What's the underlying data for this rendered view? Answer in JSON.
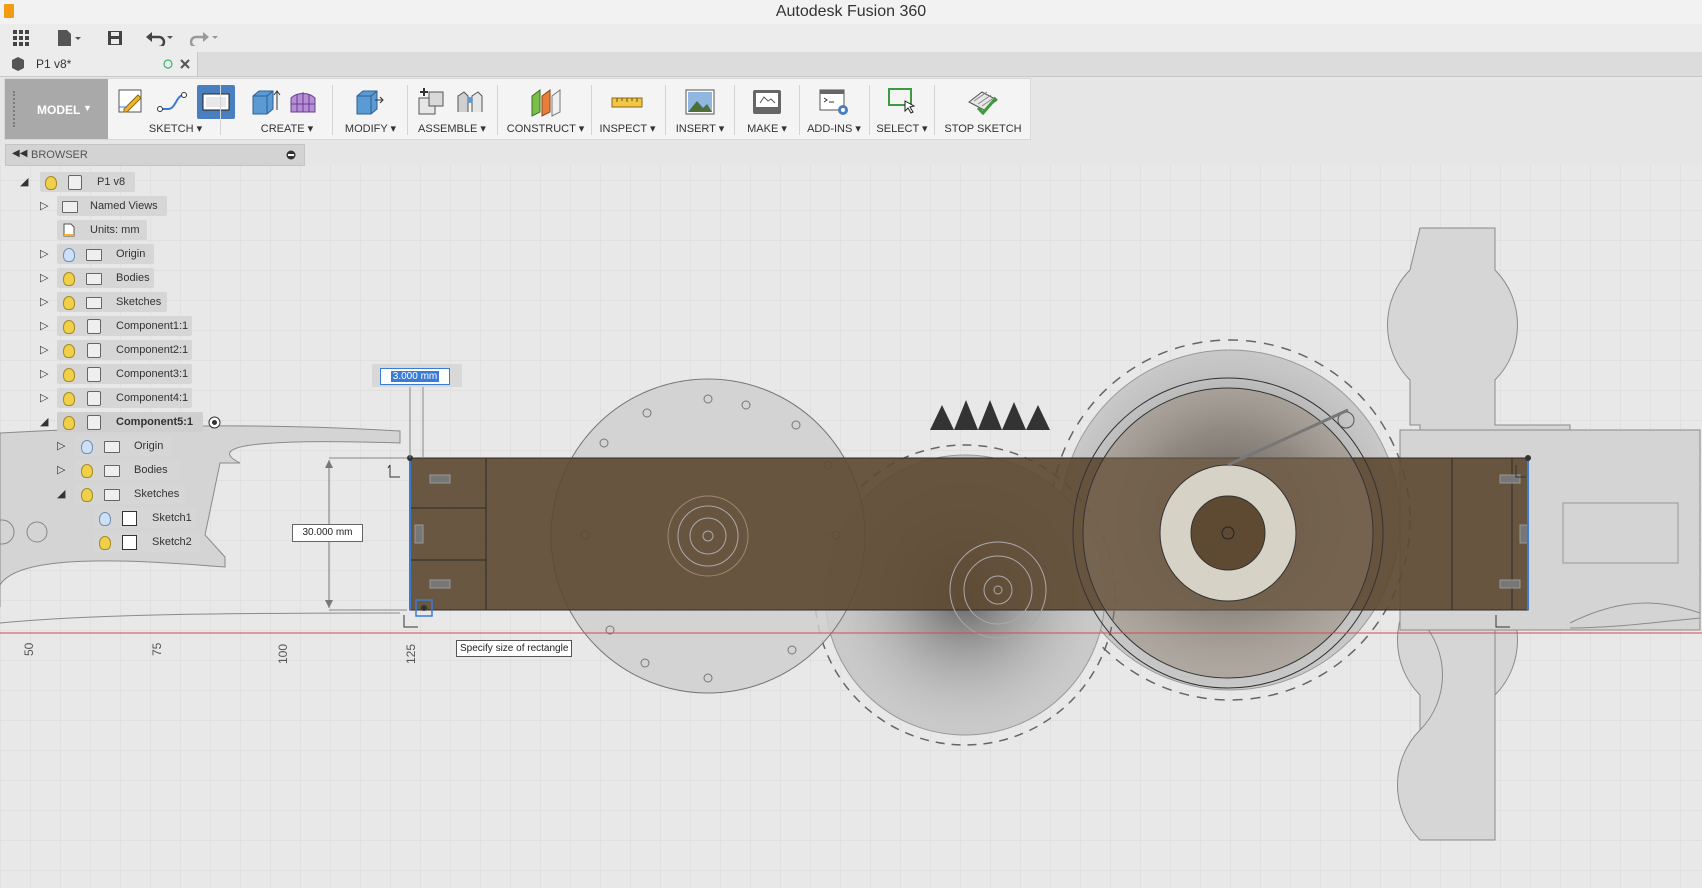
{
  "app": {
    "title": "Autodesk Fusion 360"
  },
  "document": {
    "tab_name": "P1 v8*"
  },
  "toolbar": {
    "workspace": "MODEL",
    "groups": [
      "SKETCH",
      "CREATE",
      "MODIFY",
      "ASSEMBLE",
      "CONSTRUCT",
      "INSPECT",
      "INSERT",
      "MAKE",
      "ADD-INS",
      "SELECT",
      "STOP SKETCH"
    ]
  },
  "browser": {
    "title": "BROWSER",
    "items": [
      {
        "label": "P1 v8"
      },
      {
        "label": "Named Views"
      },
      {
        "label": "Units: mm"
      },
      {
        "label": "Origin"
      },
      {
        "label": "Bodies"
      },
      {
        "label": "Sketches"
      },
      {
        "label": "Component1:1"
      },
      {
        "label": "Component2:1"
      },
      {
        "label": "Component3:1"
      },
      {
        "label": "Component4:1"
      },
      {
        "label": "Component5:1"
      },
      {
        "label": "Origin"
      },
      {
        "label": "Bodies"
      },
      {
        "label": "Sketches"
      },
      {
        "label": "Sketch1"
      },
      {
        "label": "Sketch2"
      }
    ]
  },
  "canvas": {
    "dimension_input": "3.000 mm",
    "dimension_height": "30.000 mm",
    "tooltip": "Specify size of rectangle",
    "ruler_labels": [
      "50",
      "75",
      "100",
      "125"
    ]
  },
  "colors": {
    "body_fill": "#5e4a33",
    "selection_blue": "#3a7bd5",
    "axis_red": "#d84a4a"
  }
}
